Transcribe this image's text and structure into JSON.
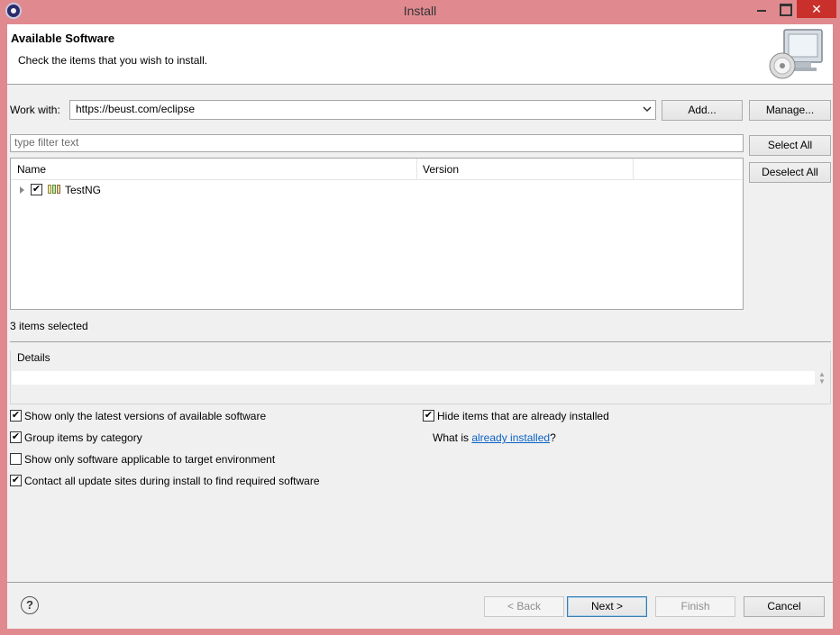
{
  "window": {
    "title": "Install",
    "close_glyph": "✕"
  },
  "header": {
    "title": "Available Software",
    "subtitle": "Check the items that you wish to install."
  },
  "work_with": {
    "label": "Work with:",
    "value": "https://beust.com/eclipse",
    "add_label": "Add...",
    "manage_label": "Manage..."
  },
  "filter": {
    "placeholder": "type filter text"
  },
  "tree": {
    "columns": [
      "Name",
      "Version"
    ],
    "items": [
      {
        "name": "TestNG",
        "version": "",
        "checked": true,
        "expander": "collapsed"
      }
    ]
  },
  "side_buttons": {
    "select_all": "Select All",
    "deselect_all": "Deselect All"
  },
  "selection_status": "3 items selected",
  "details": {
    "legend": "Details",
    "text": ""
  },
  "options": {
    "latest_versions": {
      "label": "Show only the latest versions of available software",
      "checked": true
    },
    "group_by_category": {
      "label": "Group items by category",
      "checked": true
    },
    "applicable_only": {
      "label": "Show only software applicable to target environment",
      "checked": false
    },
    "contact_all_sites": {
      "label": "Contact all update sites during install to find required software",
      "checked": true
    },
    "hide_installed": {
      "label": "Hide items that are already installed",
      "checked": true
    }
  },
  "already_installed": {
    "prefix": "What is ",
    "link": "already installed",
    "suffix": "?"
  },
  "footer": {
    "help_glyph": "?",
    "back_label": "< Back",
    "next_label": "Next >",
    "finish_label": "Finish",
    "cancel_label": "Cancel"
  },
  "check_glyph": "✔",
  "colors": {
    "title_bar": "#e08a8f",
    "close_button": "#c9302c",
    "link": "#0b62c4",
    "dialog_bg": "#f0f0f0"
  },
  "icons": {
    "app": "eclipse-icon",
    "header_art": "computer-cd-icon",
    "category": "category-icon",
    "help": "help-icon"
  }
}
